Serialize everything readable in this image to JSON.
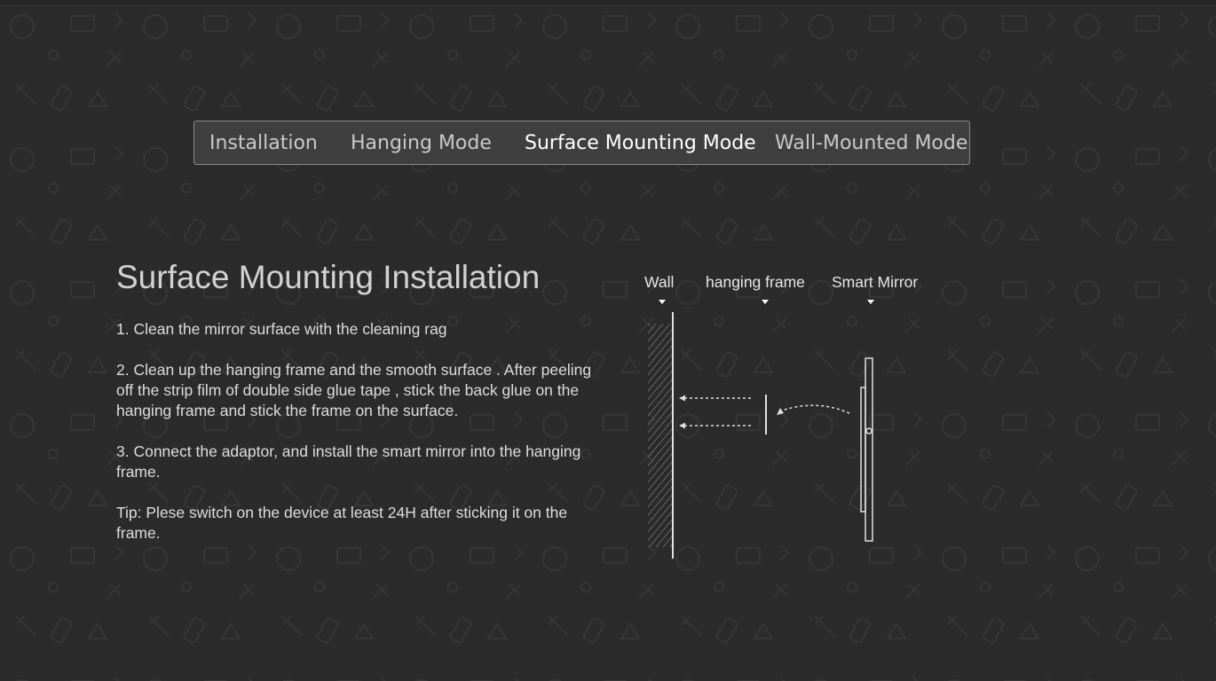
{
  "tabs": [
    {
      "label": "Installation",
      "active": false
    },
    {
      "label": "Hanging Mode",
      "active": false
    },
    {
      "label": "Surface Mounting Mode",
      "active": true
    },
    {
      "label": "Wall-Mounted Mode",
      "active": false
    }
  ],
  "content": {
    "title": "Surface Mounting Installation",
    "steps": [
      "1. Clean the mirror surface with the cleaning rag",
      "2. Clean up the hanging frame and the smooth surface . After peeling off the strip film of double side glue tape , stick the back glue on the hanging frame and stick the frame on the surface.",
      "3. Connect the adaptor, and install the smart mirror into the hanging frame.",
      "Tip: Plese switch on the device at least 24H after sticking it on the frame."
    ]
  },
  "diagram": {
    "labels": {
      "wall": "Wall",
      "frame": "hanging frame",
      "mirror": "Smart Mirror"
    }
  },
  "colors": {
    "background": "#2b2b2b",
    "tab_bar": "#3f3f3f",
    "tab_border": "#8a8a8a",
    "text": "#e6e6e6",
    "active_tab": "#ffffff"
  }
}
